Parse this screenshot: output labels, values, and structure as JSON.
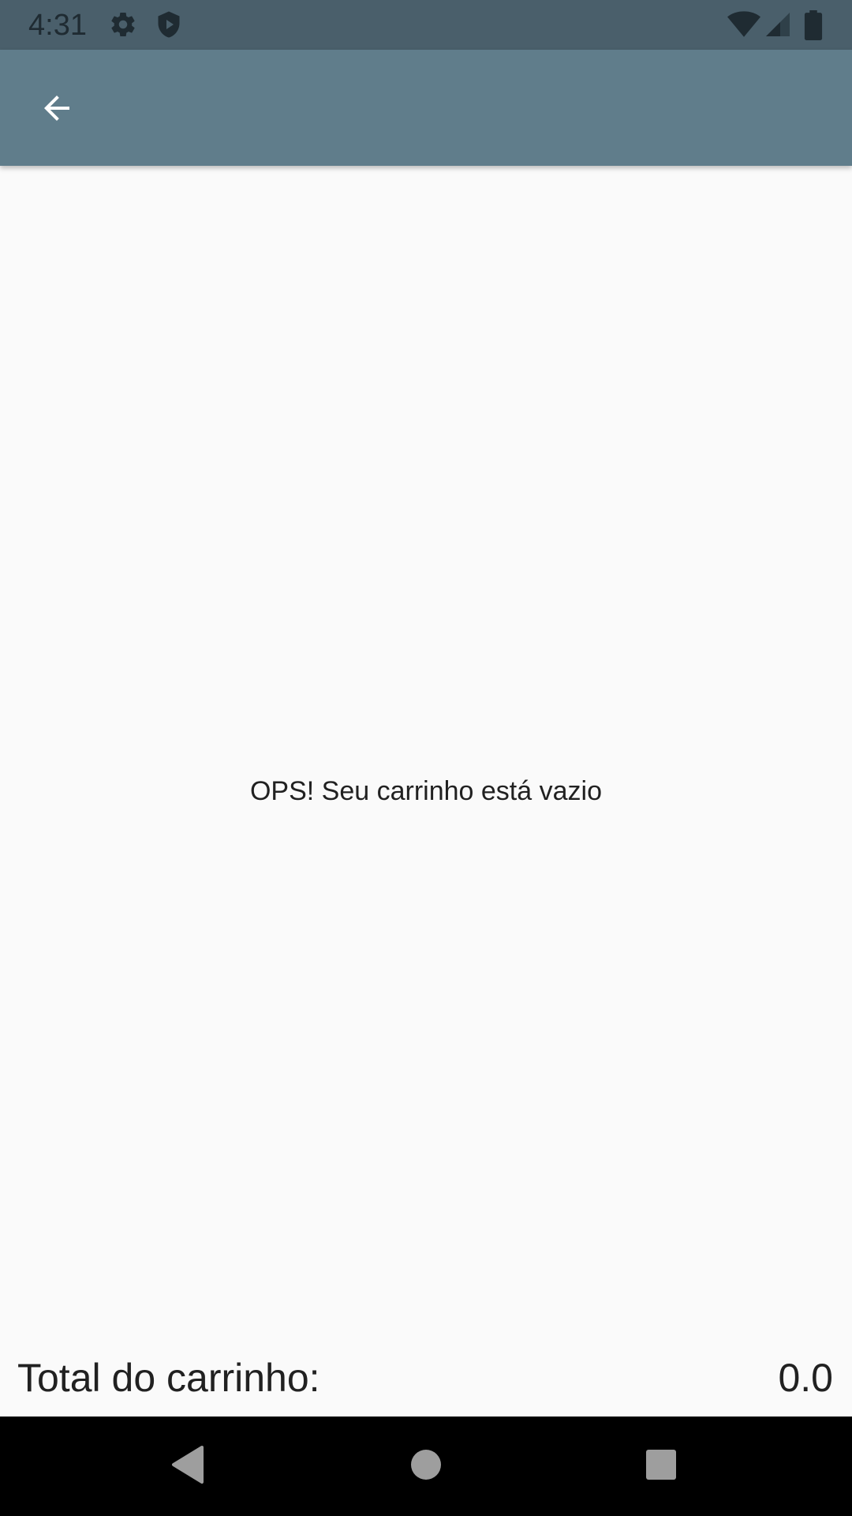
{
  "status_bar": {
    "time": "4:31",
    "icons": [
      "gear-icon",
      "shield-play-icon",
      "wifi-icon",
      "signal-icon",
      "battery-icon"
    ]
  },
  "app_bar": {
    "back_icon": "arrow-back-icon",
    "color": "#607d8b"
  },
  "cart": {
    "empty_message": "OPS! Seu carrinho está vazio",
    "total_label": "Total do carrinho:",
    "total_value": "0.0"
  },
  "nav_bar": {
    "buttons": [
      "back-triangle-icon",
      "home-circle-icon",
      "recents-square-icon"
    ]
  },
  "colors": {
    "status_bar": "#4a5f6b",
    "app_bar": "#607d8b",
    "background": "#fafafa",
    "text": "#212121"
  }
}
